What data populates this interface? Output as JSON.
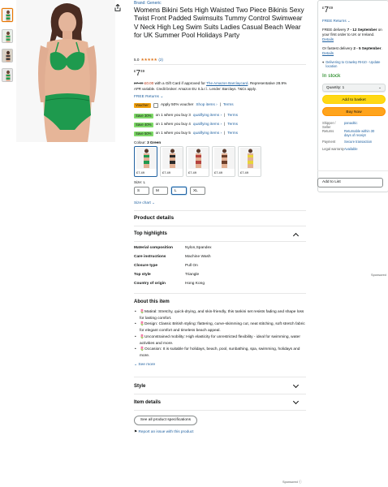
{
  "thumbnails": [
    "image-1",
    "image-2",
    "image-3",
    "image-4"
  ],
  "product": {
    "brand": "Brand: Generic",
    "title": "Womens Bikini Sets High Waisted Two Piece Bikinis Sexy Twist Front Padded Swimsuits Tummy Control Swimwear V Neck High Leg Swim Suits Ladies Casual Beach Wear for UK Summer Pool Holidays Party",
    "rating_value": "5.0",
    "stars": "★★★★★",
    "rating_count": "(2)",
    "price_currency": "£",
    "price_whole": "7",
    "price_fraction": "49",
    "offer_old": "£7.49",
    "offer_new": "£0.00",
    "offer_text": "with a Gift Card if approved for",
    "offer_card": "The Amazon Barclaycard",
    "offer_rep": ". Representative 28.9%",
    "credit_text": "APR variable. Credit broker: Amazon EU S.à.r.l.. Lender: Barclays. T&Cs apply.",
    "returns": "FREE Returns",
    "voucher_badge": "Voucher:",
    "voucher_text": "Apply 50% voucher",
    "shop_items": "Shop items ›",
    "terms": "Terms",
    "promos": [
      {
        "badge": "Save 30%",
        "text": "on 1 when you buy 3",
        "link": "qualifying items ›",
        "terms": "Terms"
      },
      {
        "badge": "Save 40%",
        "text": "on 1 when you buy 4",
        "link": "qualifying items ›",
        "terms": "Terms"
      },
      {
        "badge": "Save 50%",
        "text": "on 1 when you buy 5",
        "link": "qualifying items ›",
        "terms": "Terms"
      }
    ],
    "colour_label": "Colour:",
    "colour_value": "3 Green",
    "swatches": [
      {
        "price": "£7.49",
        "color": "#1f9a4f"
      },
      {
        "price": "£7.49",
        "color": "#2a2a2a"
      },
      {
        "price": "£7.49",
        "color": "#b5433f"
      },
      {
        "price": "£7.49",
        "color": "#6d3f2a"
      },
      {
        "price": "£7.49",
        "color": "#e8d43a"
      }
    ],
    "size_label": "Size:",
    "size_value": "L",
    "sizes": [
      "S",
      "M",
      "L",
      "XL"
    ],
    "size_chart": "Size chart"
  },
  "buybox": {
    "price_currency": "£",
    "price_whole": "7",
    "price_fraction": "49",
    "free_returns": "FREE Returns",
    "delivery_prefix": "FREE delivery",
    "delivery_date": "7 - 12 September",
    "delivery_suffix": "on your first order to UK or Ireland.",
    "details": "Details",
    "fastest_prefix": "Or fastest delivery",
    "fastest_date": "2 - 5 September",
    "location": "Delivering to Crawley RH10 - Update location",
    "stock": "In stock",
    "quantity": "Quantity: 1",
    "add_to_basket": "Add to basket",
    "buy_now": "Buy Now",
    "rows": [
      {
        "k": "Shipper / Seller",
        "v": "panaoltic"
      },
      {
        "k": "Returns",
        "v": "Returnable within 30 days of receipt"
      },
      {
        "k": "Payment",
        "v": "Secure transaction"
      },
      {
        "k": "Legal warranty",
        "v": "Available"
      }
    ],
    "add_to_list": "Add to List"
  },
  "details": {
    "heading": "Product details",
    "highlights": "Top highlights",
    "rows": [
      {
        "k": "Material composition",
        "v": "Nylon,Spandex"
      },
      {
        "k": "Care instructions",
        "v": "Machine Wash"
      },
      {
        "k": "Closure type",
        "v": "Pull On"
      },
      {
        "k": "Top style",
        "v": "Triangle"
      },
      {
        "k": "Country of origin",
        "v": "Hong Kong"
      }
    ],
    "about_heading": "About this item",
    "bullets": [
      "🌷Matiral: Stretchy, quick-drying, and skin-friendly, this tankini set resists fading and shape loss for lasting comfort.",
      "🌷Design: Classic British styling: flattering, curve-skimming cut, neat stitching, soft stretch fabric for elegant comfort and timeless beach appeal.",
      "🌷Unconstrained mobility: High elasticity for unrestricted flexibility - ideal for swimming, water activities and more.",
      "🌷Occasion: It is suitable for holidays, beach, pool, sunbathing, spa, swimming, holidays and more."
    ],
    "see_more": "See more",
    "style": "Style",
    "item_details": "Item details",
    "all_specs": "See all product specifications",
    "report": "Report an issue with this product"
  },
  "sponsored": "Sponsored"
}
